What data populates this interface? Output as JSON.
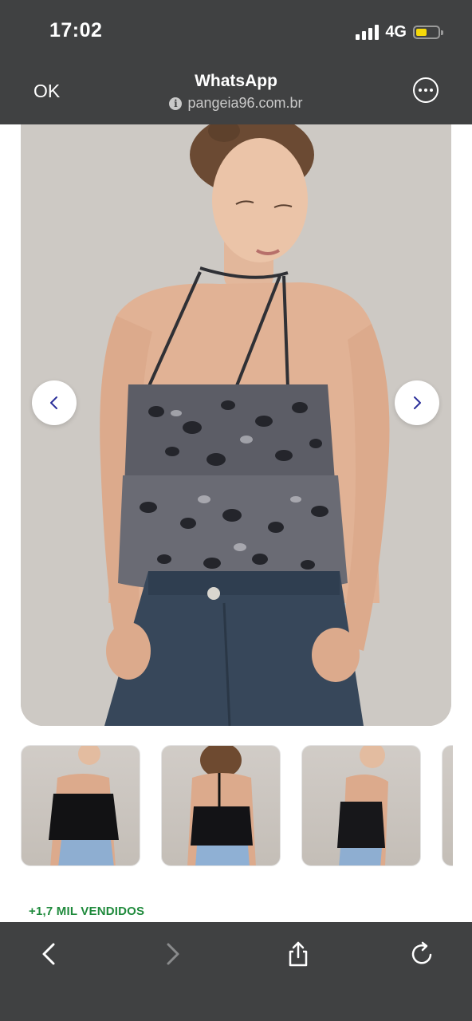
{
  "status_bar": {
    "time": "17:02",
    "network": "4G",
    "battery_level": 0.4,
    "battery_color": "#f5d90a"
  },
  "browser_header": {
    "close_label": "OK",
    "title": "WhatsApp",
    "url": "pangeia96.com.br",
    "info_icon": "info-icon",
    "menu_icon": "more-options-icon"
  },
  "product": {
    "gallery": {
      "prev_icon": "chevron-left-icon",
      "next_icon": "chevron-right-icon",
      "thumbnail_count_visible": 4
    },
    "sold_label": "+1,7 MIL VENDIDOS",
    "sold_color": "#1f8a3c"
  },
  "toolbar": {
    "back_icon": "back-icon",
    "forward_icon": "forward-icon",
    "share_icon": "share-icon",
    "reload_icon": "reload-icon"
  },
  "colors": {
    "chrome_bg": "#404142",
    "accent_arrow": "#2b2f9a"
  }
}
